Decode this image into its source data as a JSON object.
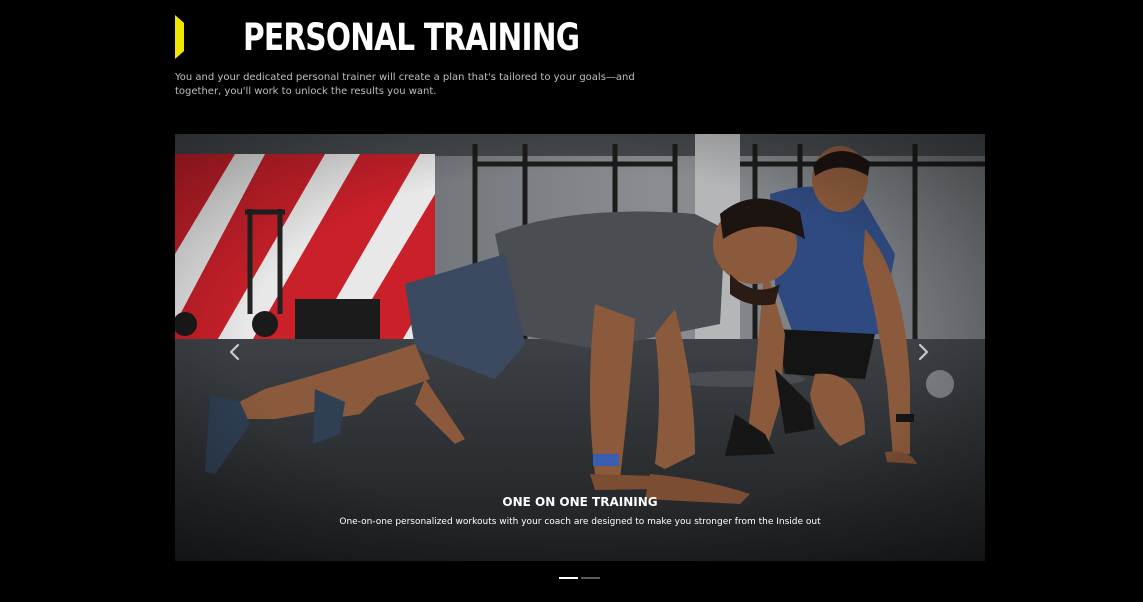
{
  "header": {
    "title": "PERSONAL TRAINING",
    "description": "You and your dedicated personal trainer will create a plan that's tailored to your goals—and together, you'll work to unlock the results you want."
  },
  "colors": {
    "background": "#000000",
    "accent": "#f2e600",
    "text": "#ffffff",
    "muted_text": "#bfbfbf"
  },
  "slider": {
    "prev_icon": "chevron-left-icon",
    "next_icon": "chevron-right-icon",
    "active_index": 0,
    "slides": [
      {
        "title": "ONE ON ONE TRAINING",
        "text": "One-on-one personalized workouts with your coach are designed to make you stronger from the Inside out"
      }
    ],
    "dot_count": 2
  }
}
